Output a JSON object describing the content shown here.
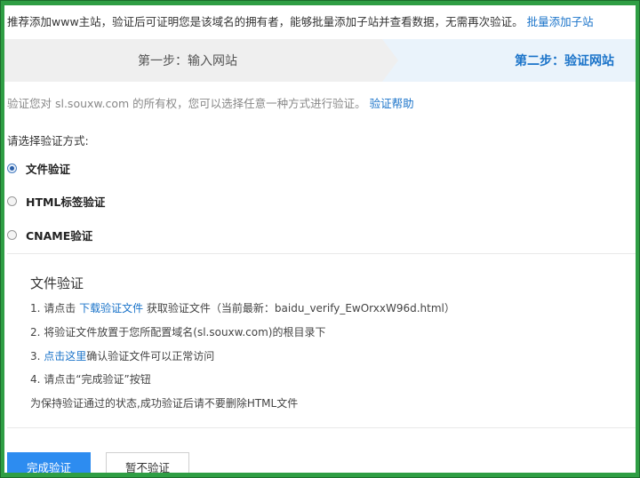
{
  "notice": {
    "text": "推荐添加www主站，验证后可证明您是该域名的拥有者，能够批量添加子站并查看数据，无需再次验证。",
    "link": "批量添加子站"
  },
  "steps": {
    "step1": "第一步：输入网站",
    "step2": "第二步：验证网站"
  },
  "verify": {
    "desc": "验证您对 sl.souxw.com 的所有权，您可以选择任意一种方式进行验证。",
    "help_link": "验证帮助"
  },
  "method": {
    "label": "请选择验证方式:",
    "options": [
      {
        "label": "文件验证",
        "checked": true
      },
      {
        "label": "HTML标签验证",
        "checked": false
      },
      {
        "label": "CNAME验证",
        "checked": false
      }
    ]
  },
  "file_verify": {
    "title": "文件验证",
    "step1_pre": "1. 请点击 ",
    "step1_link": "下载验证文件",
    "step1_post": " 获取验证文件（当前最新：baidu_verify_EwOrxxW96d.html）",
    "step2": "2. 将验证文件放置于您所配置域名(sl.souxw.com)的根目录下",
    "step3_pre": "3. ",
    "step3_link": "点击这里",
    "step3_post": "确认验证文件可以正常访问",
    "step4": "4. 请点击“完成验证”按钮",
    "note": "为保持验证通过的状态,成功验证后请不要删除HTML文件"
  },
  "buttons": {
    "complete": "完成验证",
    "skip": "暂不验证"
  },
  "colors": {
    "frame": "#2f9e44",
    "link": "#1a73c9",
    "primary": "#2d8cf0"
  }
}
